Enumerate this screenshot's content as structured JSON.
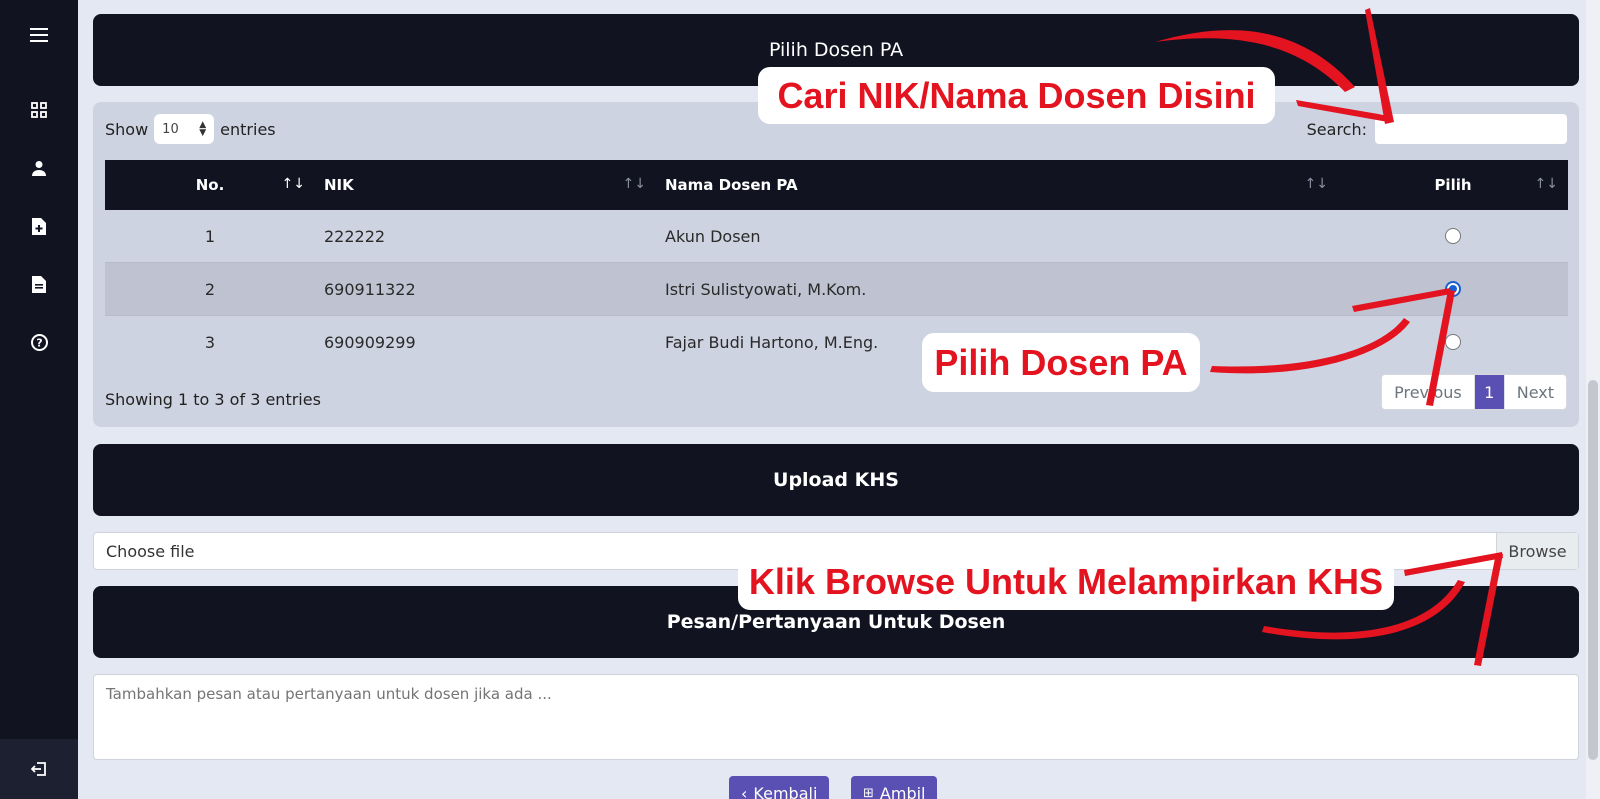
{
  "sidebar": {
    "icons": [
      "menu-icon",
      "dashboard-icon",
      "user-icon",
      "file-add-icon",
      "document-icon",
      "help-icon",
      "logout-icon"
    ]
  },
  "section_pilih": {
    "title": "Pilih Dosen PA"
  },
  "table_controls": {
    "show_label": "Show",
    "entries_value": "10",
    "entries_label": "entries",
    "search_label": "Search:",
    "search_value": ""
  },
  "table": {
    "headers": [
      "No.",
      "NIK",
      "Nama Dosen PA",
      "Pilih"
    ],
    "rows": [
      {
        "no": "1",
        "nik": "222222",
        "nama": "Akun Dosen",
        "selected": false
      },
      {
        "no": "2",
        "nik": "690911322",
        "nama": "Istri Sulistyowati, M.Kom.",
        "selected": true
      },
      {
        "no": "3",
        "nik": "690909299",
        "nama": "Fajar Budi Hartono, M.Eng.",
        "selected": false
      }
    ],
    "info": "Showing 1 to 3 of 3 entries",
    "pagination": {
      "previous": "Previous",
      "page": "1",
      "next": "Next"
    }
  },
  "section_upload": {
    "title": "Upload KHS",
    "file_label": "Choose file",
    "browse_label": "Browse"
  },
  "section_pesan": {
    "title": "Pesan/Pertanyaan Untuk Dosen",
    "placeholder": "Tambahkan pesan atau pertanyaan untuk dosen jika ada ..."
  },
  "buttons": {
    "back_label": "Kembali",
    "submit_label": "Ambil"
  },
  "annotations": {
    "search_hint": "Cari NIK/Nama Dosen Disini",
    "select_hint": "Pilih Dosen PA",
    "browse_hint": "Klik Browse Untuk Melampirkan KHS"
  },
  "colors": {
    "accent": "#5a4fb3",
    "dark": "#111320",
    "annotation_red": "#e3131f"
  }
}
